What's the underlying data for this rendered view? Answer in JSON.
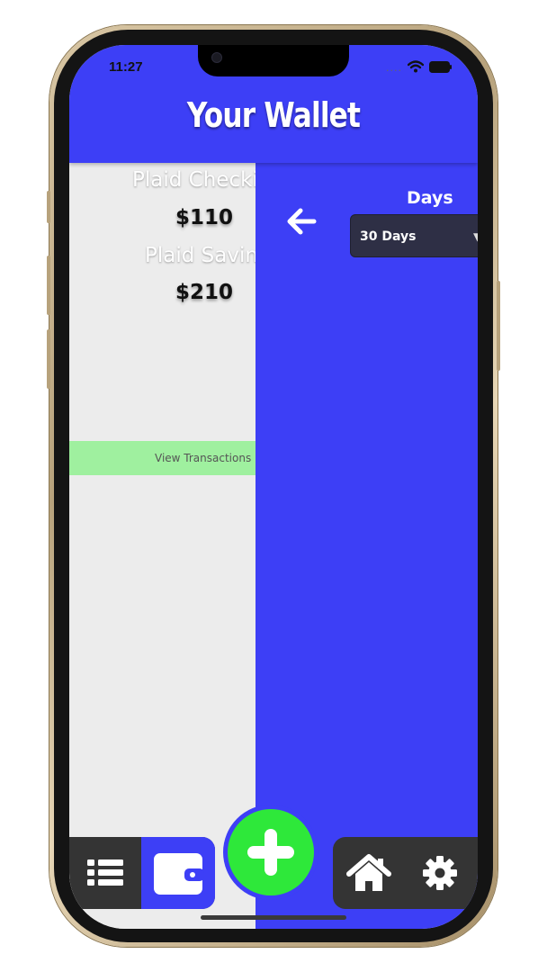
{
  "status_bar": {
    "time": "11:27",
    "signal": "...."
  },
  "header": {
    "title": "Your Wallet"
  },
  "accounts": [
    {
      "name": "Plaid Checking",
      "amount": "$110"
    },
    {
      "name": "Plaid Saving",
      "amount": "$210"
    }
  ],
  "view_transactions_label": "View Transactions",
  "filter": {
    "days_label": "Days",
    "days_selected": "30 Days"
  },
  "colors": {
    "primary_blue": "#3d3ff6",
    "add_green": "#2ee83a",
    "view_tx_green": "#9ff09f",
    "nav_dark": "#343434"
  },
  "icons": {
    "back": "arrow-left-icon",
    "list": "list-icon",
    "wallet": "wallet-icon",
    "add": "plus-icon",
    "home": "home-icon",
    "settings": "gear-icon"
  }
}
